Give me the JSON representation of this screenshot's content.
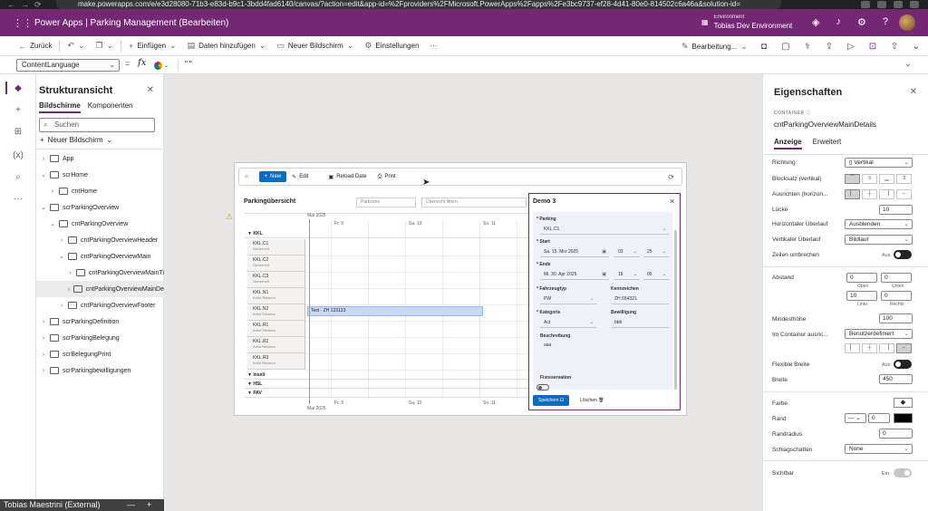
{
  "browser": {
    "url": "make.powerapps.com/e/e3d28080-71b3-e83d-b9c1-3bdd4fad6140/canvas/?action=edit&app-id=%2Fproviders%2FMicrosoft.PowerApps%2Fapps%2Fe3bc9737-ef28-4d41-80e0-814502c6a46a&solution-id="
  },
  "header": {
    "app_title": "Power Apps  |  Parking Management (Bearbeiten)",
    "env_label": "Environment",
    "env_name": "Tobias Dev Environment"
  },
  "commands": {
    "back": "Zurück",
    "insert": "Einfügen",
    "add_data": "Daten hinzufügen",
    "new_screen": "Neuer Bildschirm",
    "settings": "Einstellungen",
    "more": "···",
    "editing": "Bearbeitung..."
  },
  "formula": {
    "property": "ContentLanguage",
    "fx": "fx",
    "value": "\"\""
  },
  "tree": {
    "title": "Strukturansicht",
    "tab_screens": "Bildschirme",
    "tab_components": "Komponenten",
    "search_placeholder": "Suchen",
    "new_screen": "Neuer Bildschirm",
    "items": [
      {
        "label": "App"
      },
      {
        "label": "scrHome"
      },
      {
        "label": "cntHome"
      },
      {
        "label": "scrParkingOverview"
      },
      {
        "label": "cntParkingOverview"
      },
      {
        "label": "cntParkingOverviewHeader"
      },
      {
        "label": "cntParkingOverviewMain"
      },
      {
        "label": "cntParkingOverviewMainTi"
      },
      {
        "label": "cntParkingOverviewMainDe"
      },
      {
        "label": "cntParkingOverviewFooter"
      },
      {
        "label": "scrParkingDefinition"
      },
      {
        "label": "scrParkingBelegung"
      },
      {
        "label": "scrBelegungPrint"
      },
      {
        "label": "scrParkingbewilligungen"
      }
    ]
  },
  "app": {
    "toolbar": {
      "new": "New",
      "edit": "Edit",
      "reload": "Reload Date",
      "print": "Print"
    },
    "plan": {
      "title": "Parkingübersicht",
      "zone_placeholder": "Parkzone",
      "filter_placeholder": "Übersicht filtern",
      "month_top": "Mai 2025",
      "month_bottom": "Mai 2025",
      "days": [
        "Fr. 9",
        "Sa. 10",
        "So. 11"
      ],
      "groups": [
        "KKL",
        "Inseli",
        "HSL",
        "PAV"
      ],
      "slots": [
        {
          "name": "KKL.C1",
          "sub": "Sicherheit"
        },
        {
          "name": "KKL.C2",
          "sub": "Sicherheit"
        },
        {
          "name": "KKL.C3",
          "sub": "Sicherheit"
        },
        {
          "name": "KKL.N1",
          "sub": "Artist Relation"
        },
        {
          "name": "KKL.N2",
          "sub": "Artist Relation"
        },
        {
          "name": "KKL.R1",
          "sub": "Artist Relation"
        },
        {
          "name": "KKL.R2",
          "sub": "Artist Relation"
        },
        {
          "name": "KKL.R3",
          "sub": "Artist Relation"
        }
      ],
      "reservation": "Test · ZH 123123"
    },
    "details": {
      "title": "Demo 3",
      "parking_label": "Parking",
      "parking_value": "KKL.C1",
      "start_label": "Start",
      "start_date": "Sa. 15. Mrz 2025",
      "start_hour": "03",
      "start_min": "25",
      "end_label": "Ende",
      "end_date": "Mi. 30. Apr 2025",
      "end_hour": "16",
      "end_min": "05",
      "vehicle_label": "Fahrzeugtyp",
      "vehicle_value": "PW",
      "plate_label": "Kennzeichen",
      "plate_value": "ZH 654321",
      "category_label": "Kategorie",
      "category_value": "Act",
      "permit_label": "Bewilligung",
      "permit_value": "bbb",
      "desc_label": "Beschreibung",
      "desc_value": "aaa",
      "fixres_label": "Fixreservation",
      "save": "Speichern",
      "delete": "Löschen"
    }
  },
  "props": {
    "title": "Eigenschaften",
    "control_type": "CONTAINER",
    "control_name": "cntParkingOverviewMainDetails",
    "tab_display": "Anzeige",
    "tab_advanced": "Erweitert",
    "direction_label": "Richtung",
    "direction_value": "Vertikal",
    "justify_label": "Blocksatz (vertikal)",
    "align_label": "Ausrichten (horizon...",
    "gap_label": "Lücke",
    "gap_value": "10",
    "hoverflow_label": "Horizontaler Überlauf",
    "hoverflow_value": "Ausblenden",
    "voverflow_label": "Vertikaler Überlauf",
    "voverflow_value": "Bildlauf",
    "wrap_label": "Zeilen umbrechen",
    "wrap_state": "Aus",
    "padding_label": "Abstand",
    "padding_top": "0",
    "padding_bottom": "0",
    "padding_left": "10",
    "padding_right": "0",
    "padding_top_lbl": "Oben",
    "padding_bottom_lbl": "Unten",
    "padding_left_lbl": "Links",
    "padding_right_lbl": "Rechts",
    "minheight_label": "Mindesthöhe",
    "minheight_value": "100",
    "incontainer_label": "Im Container ausric...",
    "incontainer_value": "Benutzerdefiniert",
    "flexwidth_label": "Flexible Breite",
    "flexwidth_state": "Aus",
    "width_label": "Breite",
    "width_value": "450",
    "color_label": "Farbe",
    "border_label": "Rand",
    "border_value": "0",
    "radius_label": "Randradius",
    "radius_value": "0",
    "shadow_label": "Schlagschatten",
    "shadow_value": "None",
    "visible_label": "Sichtbar",
    "visible_state": "Ein"
  },
  "overlay": {
    "user": "Tobias Maestrini (External)"
  },
  "colors": {
    "brand": "#742774",
    "primary": "#0f6cbd",
    "reservation": "#c7d9f5"
  }
}
